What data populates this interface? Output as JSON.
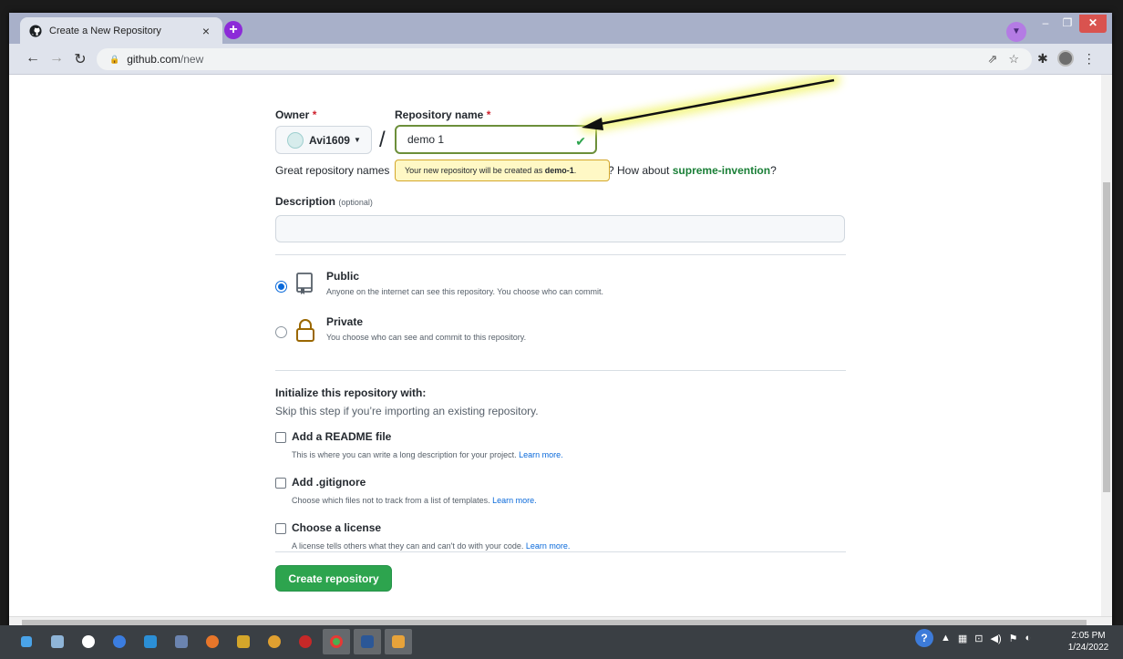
{
  "browser": {
    "tab_title": "Create a New Repository",
    "tab_close": "×",
    "new_tab": "+",
    "url_host": "github.com",
    "url_path": "/new",
    "minimize": "–",
    "maximize": "❐",
    "close": "✕"
  },
  "form": {
    "owner_label": "Owner",
    "repo_label": "Repository name",
    "required_mark": "*",
    "owner_value": "Avi1609",
    "slash": "/",
    "repo_value": "demo 1",
    "great_prefix": "Great repository names",
    "great_suffix": "? How about",
    "suggestion": "supreme-invention",
    "suggestion_end": "?",
    "tooltip_text": "Your new repository will be created as",
    "tooltip_name": "demo-1",
    "tooltip_end": ".",
    "description_label": "Description",
    "description_optional": "(optional)",
    "description_value": "",
    "visibility": {
      "selected": "public",
      "public_title": "Public",
      "public_desc": "Anyone on the internet can see this repository. You choose who can commit.",
      "private_title": "Private",
      "private_desc": "You choose who can see and commit to this repository."
    },
    "init_title": "Initialize this repository with:",
    "init_subtitle": "Skip this step if you’re importing an existing repository.",
    "options": [
      {
        "title": "Add a README file",
        "desc": "This is where you can write a long description for your project.",
        "link": "Learn more.",
        "checked": false
      },
      {
        "title": "Add .gitignore",
        "desc": "Choose which files not to track from a list of templates.",
        "link": "Learn more.",
        "checked": false
      },
      {
        "title": "Choose a license",
        "desc": "A license tells others what they can and can't do with your code.",
        "link": "Learn more.",
        "checked": false
      }
    ],
    "create_button": "Create repository"
  },
  "taskbar": {
    "time": "2:05 PM",
    "date": "1/24/2022",
    "help": "?"
  },
  "colors": {
    "primary_green": "#2da44e",
    "link_blue": "#0969da",
    "annotation_arrow_glow": "#f3f57a"
  }
}
